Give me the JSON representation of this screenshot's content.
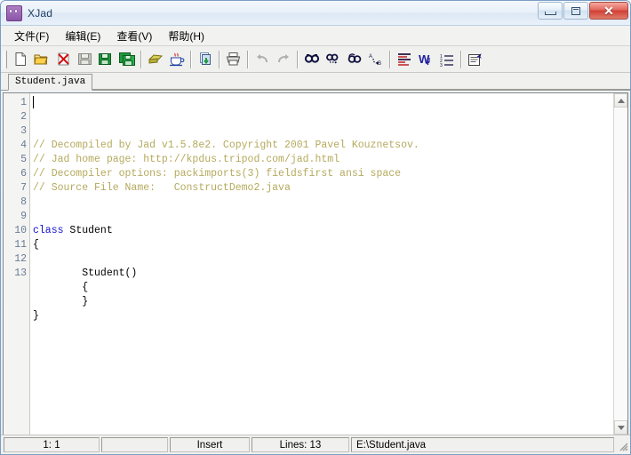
{
  "window": {
    "title": "XJad",
    "app_icon": "xjad-app-icon",
    "buttons": {
      "minimize": {
        "name": "minimize",
        "glyph": "—"
      },
      "maximize": {
        "name": "maximize",
        "glyph": "❐"
      },
      "close": {
        "name": "close",
        "glyph": "✕"
      }
    }
  },
  "menubar": {
    "items": [
      {
        "label": "文件(F)",
        "name": "menu-file"
      },
      {
        "label": "编辑(E)",
        "name": "menu-edit"
      },
      {
        "label": "查看(V)",
        "name": "menu-view"
      },
      {
        "label": "帮助(H)",
        "name": "menu-help"
      }
    ]
  },
  "toolbar": {
    "groups": [
      {
        "buttons": [
          {
            "name": "new-file-icon",
            "title": "New"
          },
          {
            "name": "open-folder-icon",
            "title": "Open"
          },
          {
            "name": "close-file-icon",
            "title": "Close"
          },
          {
            "name": "save-icon",
            "title": "Save"
          },
          {
            "name": "save-as-icon",
            "title": "Save As"
          },
          {
            "name": "save-all-icon",
            "title": "Save All"
          }
        ]
      },
      {
        "buttons": [
          {
            "name": "decompile-icon",
            "title": "Decompile"
          },
          {
            "name": "java-coffee-cup-icon",
            "title": "Run Java"
          }
        ]
      },
      {
        "buttons": [
          {
            "name": "export-icon",
            "title": "Export"
          }
        ]
      },
      {
        "buttons": [
          {
            "name": "print-icon",
            "title": "Print"
          }
        ]
      },
      {
        "buttons": [
          {
            "name": "undo-icon",
            "title": "Undo"
          },
          {
            "name": "redo-icon",
            "title": "Redo"
          }
        ]
      },
      {
        "buttons": [
          {
            "name": "find-icon",
            "title": "Find"
          },
          {
            "name": "find-next-icon",
            "title": "Find Next"
          },
          {
            "name": "find-previous-icon",
            "title": "Find Previous"
          },
          {
            "name": "replace-icon",
            "title": "Replace"
          }
        ]
      },
      {
        "buttons": [
          {
            "name": "format-text-icon",
            "title": "Format"
          },
          {
            "name": "word-wrap-icon",
            "title": "Word Wrap"
          },
          {
            "name": "line-numbers-icon",
            "title": "Line Numbers"
          }
        ]
      },
      {
        "buttons": [
          {
            "name": "properties-icon",
            "title": "Properties"
          }
        ]
      }
    ]
  },
  "tabs": [
    {
      "label": "Student.java",
      "name": "tab-student-java",
      "active": true
    }
  ],
  "editor": {
    "line_numbers": [
      "1",
      "2",
      "3",
      "4",
      "5",
      "6",
      "7",
      "8",
      "9",
      "10",
      "11",
      "12",
      "13"
    ],
    "lines": [
      {
        "n": 1,
        "segments": [
          {
            "type": "comment",
            "text": "// Decompiled by Jad v1.5.8e2. Copyright 2001 Pavel Kouznetsov."
          }
        ]
      },
      {
        "n": 2,
        "segments": [
          {
            "type": "comment",
            "text": "// Jad home page: http://kpdus.tripod.com/jad.html"
          }
        ]
      },
      {
        "n": 3,
        "segments": [
          {
            "type": "comment",
            "text": "// Decompiler options: packimports(3) fieldsfirst ansi space"
          }
        ]
      },
      {
        "n": 4,
        "segments": [
          {
            "type": "comment",
            "text": "// Source File Name:   ConstructDemo2.java"
          }
        ]
      },
      {
        "n": 5,
        "segments": [
          {
            "type": "plain",
            "text": ""
          }
        ]
      },
      {
        "n": 6,
        "segments": [
          {
            "type": "plain",
            "text": ""
          }
        ]
      },
      {
        "n": 7,
        "segments": [
          {
            "type": "keyword",
            "text": "class"
          },
          {
            "type": "plain",
            "text": " Student"
          }
        ]
      },
      {
        "n": 8,
        "segments": [
          {
            "type": "plain",
            "text": "{"
          }
        ]
      },
      {
        "n": 9,
        "segments": [
          {
            "type": "plain",
            "text": ""
          }
        ]
      },
      {
        "n": 10,
        "segments": [
          {
            "type": "plain",
            "text": "        Student()"
          }
        ]
      },
      {
        "n": 11,
        "segments": [
          {
            "type": "plain",
            "text": "        {"
          }
        ]
      },
      {
        "n": 12,
        "segments": [
          {
            "type": "plain",
            "text": "        }"
          }
        ]
      },
      {
        "n": 13,
        "segments": [
          {
            "type": "plain",
            "text": "}"
          }
        ]
      }
    ],
    "colors": {
      "comment": "#b5aa5e",
      "keyword": "#1414c8",
      "plain": "#000000",
      "gutter_text": "#6a7a96",
      "background": "#ffffff"
    }
  },
  "statusbar": {
    "cursor_position": "1: 1",
    "blank": "",
    "insert_mode": "Insert",
    "line_count": "Lines: 13",
    "file_path": "E:\\Student.java"
  }
}
